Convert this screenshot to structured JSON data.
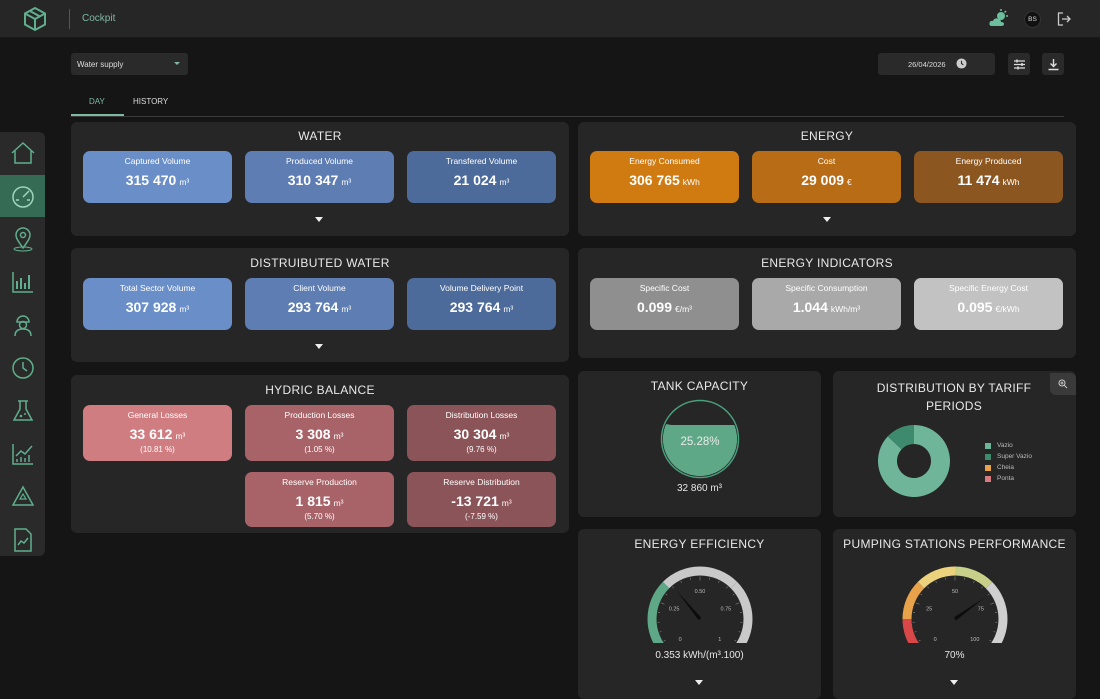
{
  "header": {
    "app_title": "Cockpit",
    "avatar_initials": "BS"
  },
  "sidebar": {
    "items": [
      {
        "icon": "home-icon",
        "active": false
      },
      {
        "icon": "speedometer-icon",
        "active": true
      },
      {
        "icon": "map-pin-icon",
        "active": false
      },
      {
        "icon": "analytics-chart-icon",
        "active": false
      },
      {
        "icon": "worker-icon",
        "active": false
      },
      {
        "icon": "clock-history-icon",
        "active": false
      },
      {
        "icon": "lab-flask-icon",
        "active": false
      },
      {
        "icon": "trend-chart-icon",
        "active": false
      },
      {
        "icon": "recycle-icon",
        "active": false
      },
      {
        "icon": "report-icon",
        "active": false
      }
    ]
  },
  "filters": {
    "selector_value": "Water supply",
    "date_value": "26/04/2026"
  },
  "tabs": [
    {
      "label": "DAY",
      "active": true
    },
    {
      "label": "HISTORY",
      "active": false
    }
  ],
  "water": {
    "title": "WATER",
    "cards": [
      {
        "label": "Captured Volume",
        "value": "315 470",
        "unit": "m³",
        "color": "#6a8fc8"
      },
      {
        "label": "Produced Volume",
        "value": "310 347",
        "unit": "m³",
        "color": "#5d7db3"
      },
      {
        "label": "Transfered Volume",
        "value": "21 024",
        "unit": "m³",
        "color": "#4d6b9a"
      }
    ]
  },
  "energy": {
    "title": "ENERGY",
    "cards": [
      {
        "label": "Energy Consumed",
        "value": "306 765",
        "unit": "kWh",
        "color": "#d07b12"
      },
      {
        "label": "Cost",
        "value": "29 009",
        "unit": "€",
        "color": "#b86c16"
      },
      {
        "label": "Energy Produced",
        "value": "11 474",
        "unit": "kWh",
        "color": "#8c5620"
      }
    ]
  },
  "distributed_water": {
    "title": "DISTRUIBUTED WATER",
    "cards": [
      {
        "label": "Total Sector Volume",
        "value": "307 928",
        "unit": "m³",
        "color": "#6a8fc8"
      },
      {
        "label": "Client Volume",
        "value": "293 764",
        "unit": "m³",
        "color": "#5d7db3"
      },
      {
        "label": "Volume Delivery Point",
        "value": "293 764",
        "unit": "m³",
        "color": "#4d6b9a"
      }
    ]
  },
  "energy_indicators": {
    "title": "ENERGY INDICATORS",
    "cards": [
      {
        "label": "Specific Cost",
        "value": "0.099",
        "unit": "€/m³",
        "color": "#8f8f8f"
      },
      {
        "label": "Specific Consumption",
        "value": "1.044",
        "unit": "kWh/m³",
        "color": "#a9a9a9"
      },
      {
        "label": "Specific Energy Cost",
        "value": "0.095",
        "unit": "€/kWh",
        "color": "#c2c2c2"
      }
    ]
  },
  "hydric_balance": {
    "title": "HYDRIC BALANCE",
    "cards": [
      {
        "label": "General Losses",
        "value": "33 612",
        "unit": "m³",
        "pct": "(10.81 %)",
        "color": "#d07d82"
      },
      {
        "label": "Production Losses",
        "value": "3 308",
        "unit": "m³",
        "pct": "(1.05 %)",
        "color": "#a86369"
      },
      {
        "label": "Distribution Losses",
        "value": "30 304",
        "unit": "m³",
        "pct": "(9.76 %)",
        "color": "#8b5459"
      },
      {
        "label": "Reserve Production",
        "value": "1 815",
        "unit": "m³",
        "pct": "(5.70 %)",
        "color": "#a86369"
      },
      {
        "label": "Reserve Distribution",
        "value": "-13 721",
        "unit": "m³",
        "pct": "(-7.59 %)",
        "color": "#8b5459"
      }
    ]
  },
  "tank": {
    "title": "TANK CAPACITY",
    "percent_label": "25.28%",
    "fill_fraction": 0.2528,
    "volume": "32 860 m³"
  },
  "tariff": {
    "title": "DISTRIBUTION BY TARIFF PERIODS",
    "legend": [
      {
        "label": "Vazio",
        "color": "#6fb59a"
      },
      {
        "label": "Super Vazio",
        "color": "#3e8a6e"
      },
      {
        "label": "Cheia",
        "color": "#e8a24a"
      },
      {
        "label": "Ponta",
        "color": "#d77b80"
      }
    ],
    "chart_data": {
      "type": "pie",
      "categories": [
        "Vazio",
        "Super Vazio",
        "Cheia",
        "Ponta"
      ],
      "values": [
        87,
        13,
        0,
        0
      ]
    }
  },
  "efficiency": {
    "title": "ENERGY EFFICIENCY",
    "ticks": [
      "0",
      "0.25",
      "0.50",
      "0.75",
      "1"
    ],
    "value_fraction": 0.353,
    "readout": "0.353 kWh/(m³.100)"
  },
  "pumping": {
    "title": "PUMPING STATIONS PERFORMANCE",
    "ticks": [
      "0",
      "25",
      "50",
      "75",
      "100"
    ],
    "value_fraction": 0.7,
    "readout": "70%"
  }
}
